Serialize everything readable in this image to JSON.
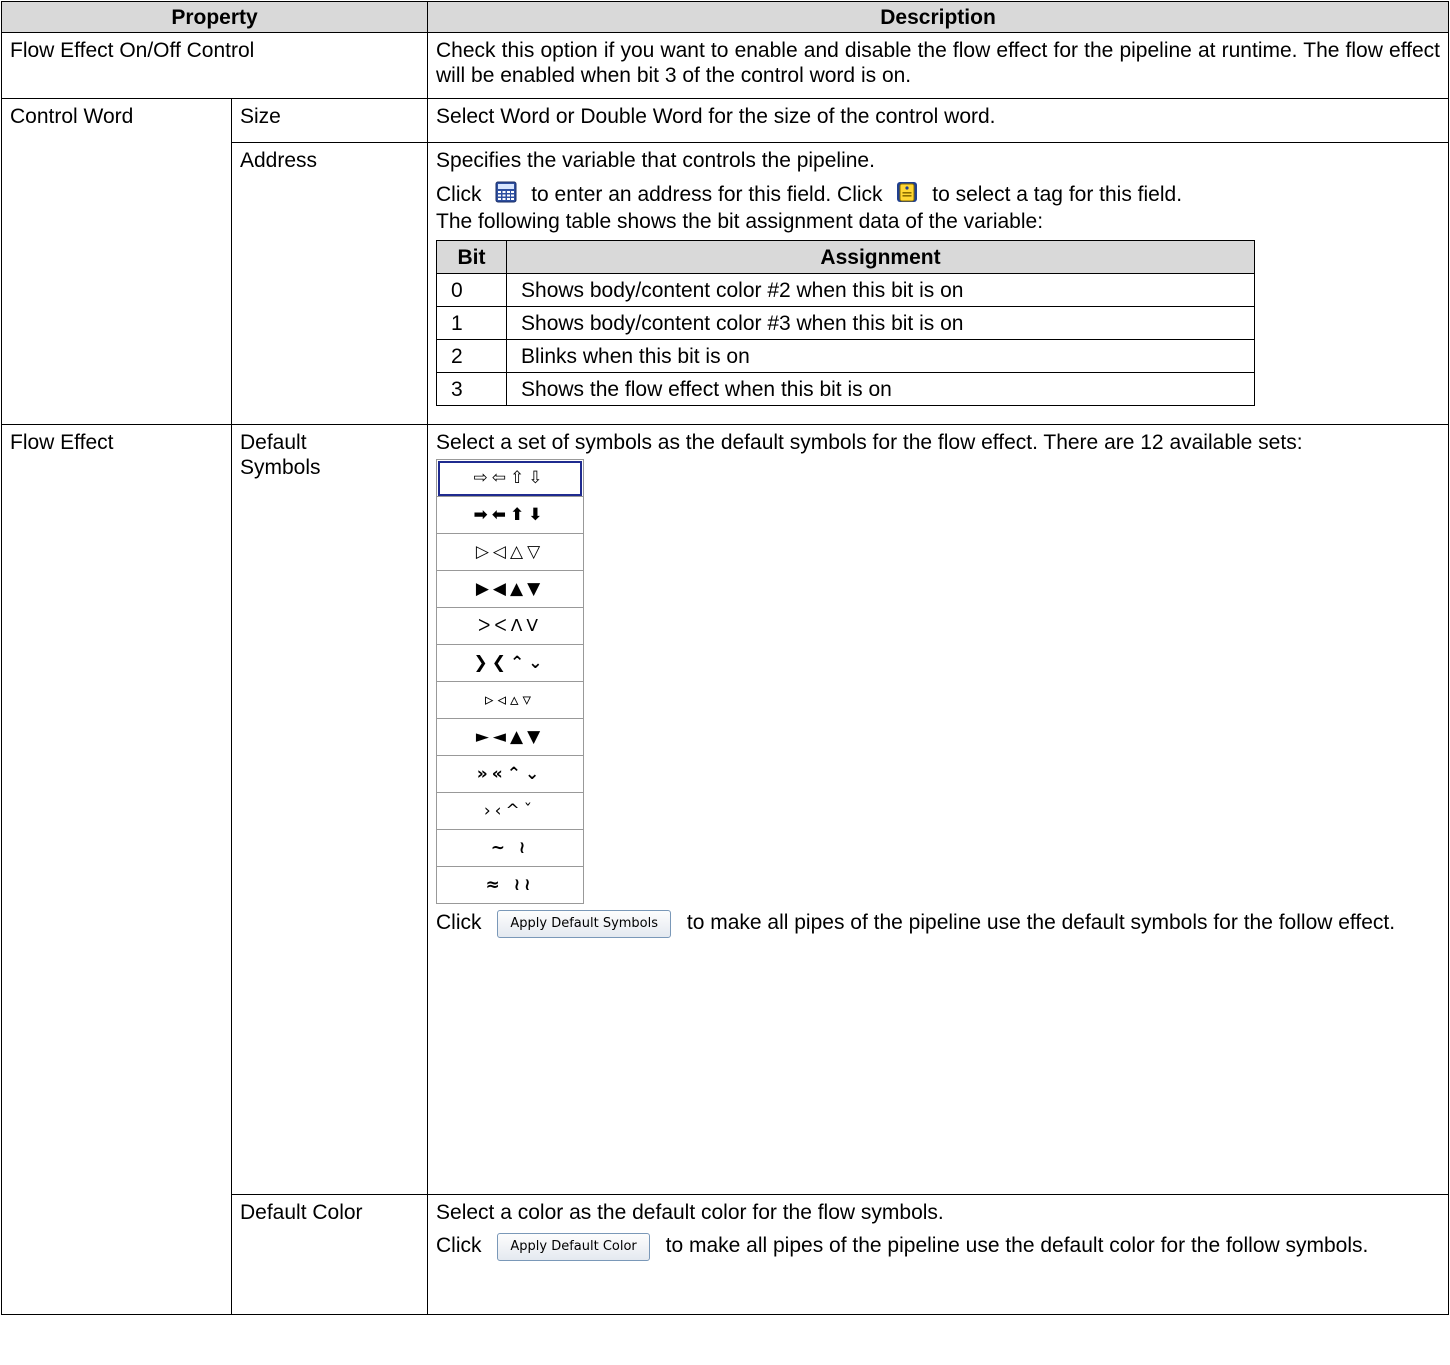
{
  "headers": {
    "property": "Property",
    "description": "Description"
  },
  "rows": {
    "flow_effect_control": {
      "property": "Flow Effect On/Off Control",
      "description": "Check this option if you want to enable and disable the flow effect for the pipeline at runtime. The flow effect will be enabled when bit 3 of the control word is on."
    },
    "control_word": {
      "group": "Control Word",
      "size": {
        "label": "Size",
        "description": "Select Word or Double Word for the size of the control word."
      },
      "address": {
        "label": "Address",
        "desc1": "Specifies the variable that controls the pipeline.",
        "click1": "Click",
        "text_enter": "to enter an address for this field. Click",
        "text_tag": "to select a tag for this field.",
        "desc3": "The following table shows the bit assignment data of the variable:",
        "bit_table": {
          "header_bit": "Bit",
          "header_assignment": "Assignment",
          "rows": [
            {
              "bit": "0",
              "assignment": "Shows body/content color #2 when this bit is on"
            },
            {
              "bit": "1",
              "assignment": "Shows body/content color #3 when this bit is on"
            },
            {
              "bit": "2",
              "assignment": "Blinks when this bit is on"
            },
            {
              "bit": "3",
              "assignment": "Shows the flow effect when this bit is on"
            }
          ]
        }
      }
    },
    "flow_effect": {
      "group": "Flow Effect",
      "default_symbols": {
        "label": "Default Symbols",
        "description": "Select a set of symbols as the default symbols for the flow effect. There are 12 available sets:",
        "symbol_sets": [
          "⇨⇦⇧⇩",
          "➡⬅⬆⬇",
          "▷◁△▽",
          "▶◀▲▼",
          "ᐳᐸᐱᐯ",
          "❯❮⌃⌄",
          "▹◃▵▿",
          "►◄▲▼",
          "»«⌃⌄",
          "›‹^ˇ",
          "∼ ≀",
          "≈ ≀≀"
        ],
        "click": "Click",
        "button_label": "Apply Default Symbols",
        "after_button": "to make all pipes of the pipeline use the default symbols for the follow effect."
      },
      "default_color": {
        "label": "Default Color",
        "description": "Select a color as the default color for the flow symbols.",
        "click": "Click",
        "button_label": "Apply Default Color",
        "after_button": "to make all pipes of the pipeline use the default color for the follow symbols."
      }
    }
  }
}
